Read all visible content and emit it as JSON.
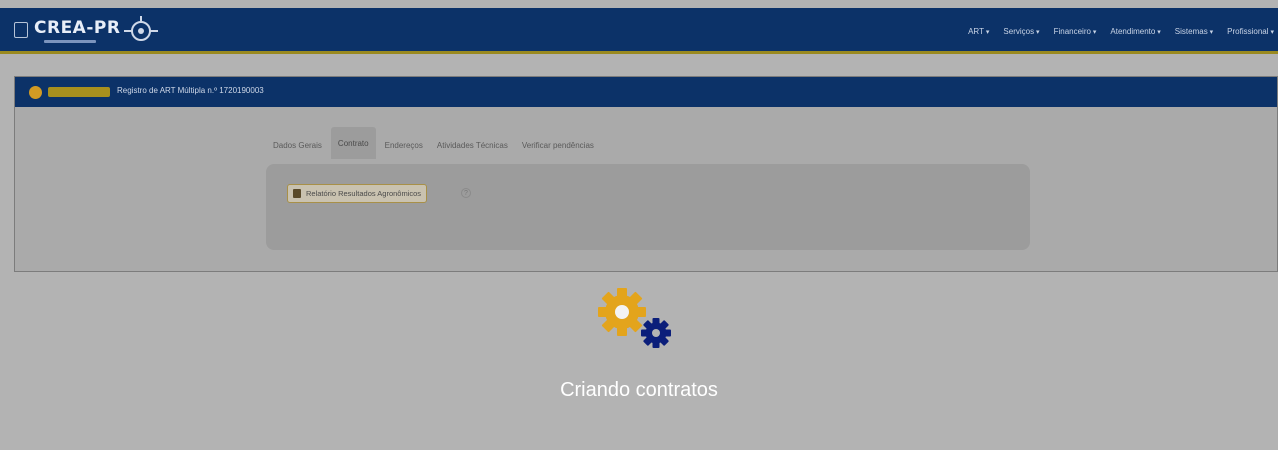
{
  "header": {
    "logo_text": "CREA-PR",
    "menu": [
      "ART",
      "Serviços",
      "Financeiro",
      "Atendimento",
      "Sistemas",
      "Profissional"
    ]
  },
  "panel": {
    "title": "Registro de ART Múltipla n.º 1720190003",
    "tabs": [
      "Dados Gerais",
      "Contrato",
      "Endereços",
      "Atividades Técnicas",
      "Verificar pendências"
    ],
    "active_tab": "Contrato",
    "report_button": "Relatório Resultados Agronômicos",
    "help_glyph": "?"
  },
  "loading": {
    "text": "Criando contratos"
  },
  "colors": {
    "navy": "#0c3268",
    "gold": "#e3a41c",
    "gear_blue": "#0b1e7a",
    "overlay": "#b3b3b3"
  },
  "icons": {
    "gear_large": "gear-icon",
    "gear_small": "gear-icon",
    "help": "question-icon",
    "report": "pdf-icon"
  }
}
